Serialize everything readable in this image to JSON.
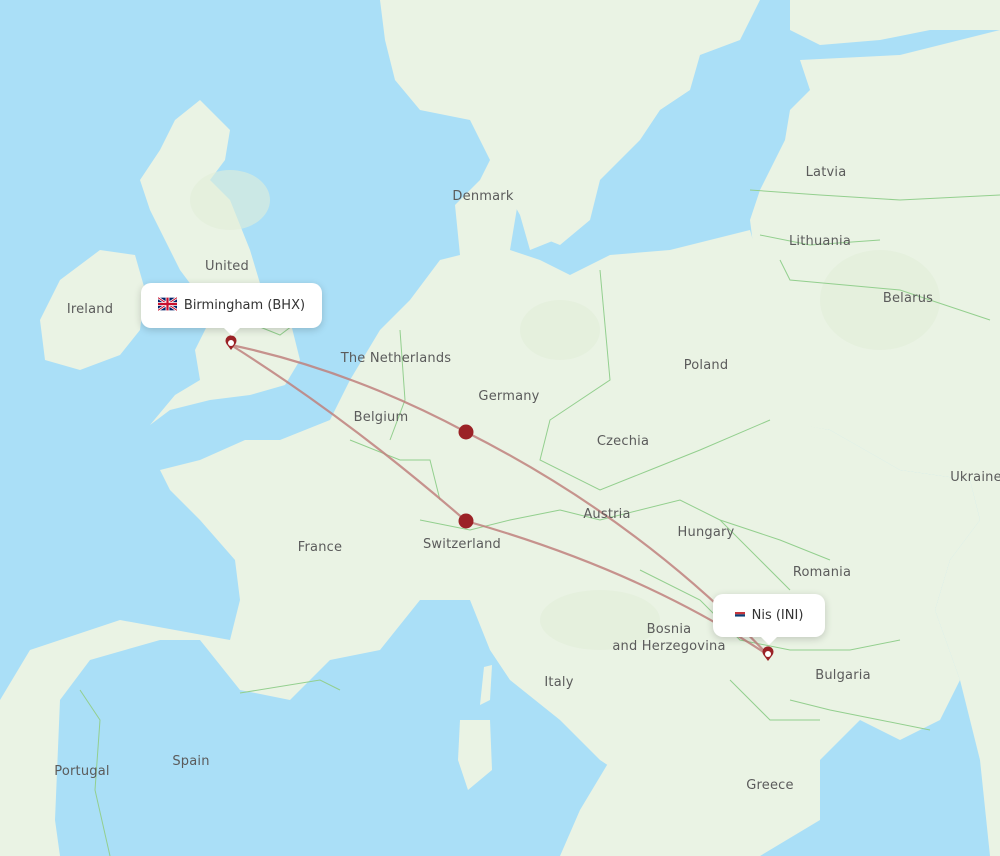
{
  "map": {
    "colors": {
      "water": "#aadff7",
      "land": "#eaf3e4",
      "land_dark": "#e1eed8",
      "border": "#93cf8e",
      "route": "#c0827e",
      "stop": "#9b2226",
      "label": "#5b5b5b"
    },
    "country_labels": [
      {
        "name": "Ireland"
      },
      {
        "name": "United Kingdom"
      },
      {
        "name": "Denmark"
      },
      {
        "name": "The Netherlands"
      },
      {
        "name": "Belgium"
      },
      {
        "name": "Germany"
      },
      {
        "name": "France"
      },
      {
        "name": "Switzerland"
      },
      {
        "name": "Poland"
      },
      {
        "name": "Czechia"
      },
      {
        "name": "Austria"
      },
      {
        "name": "Hungary"
      },
      {
        "name": "Romania"
      },
      {
        "name": "Bosnia"
      },
      {
        "name": "and Herzegovina"
      },
      {
        "name": "Italy"
      },
      {
        "name": "Spain"
      },
      {
        "name": "Portugal"
      },
      {
        "name": "Bulgaria"
      },
      {
        "name": "Greece"
      },
      {
        "name": "Latvia"
      },
      {
        "name": "Lithuania"
      },
      {
        "name": "Belarus"
      },
      {
        "name": "Ukraine"
      }
    ]
  },
  "origin": {
    "city": "Birmingham",
    "code": "BHX",
    "label": "Birmingham (BHX)",
    "flag": "uk-flag-icon"
  },
  "destination": {
    "city": "Nis",
    "code": "INI",
    "label": "Nis (INI)",
    "flag": "serbia-flag-icon"
  },
  "routes": [
    {
      "from": "BHX",
      "via": "stop-germany",
      "to": "INI"
    },
    {
      "from": "BHX",
      "via": "stop-switzerland",
      "to": "INI"
    }
  ]
}
